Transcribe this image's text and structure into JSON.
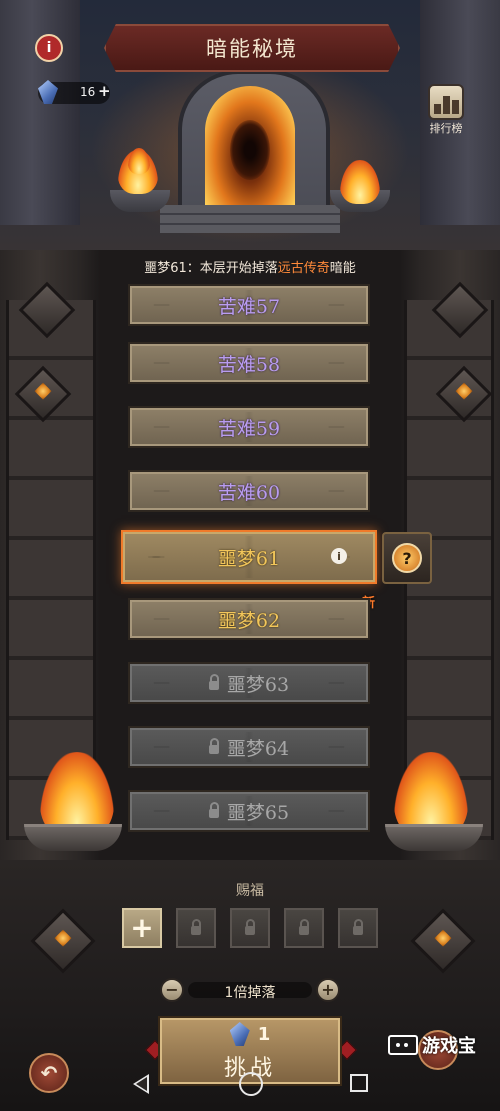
{
  "header": {
    "title": "暗能秘境",
    "info_icon": "info-icon",
    "currency": {
      "icon": "crystal-icon",
      "count": "16",
      "add_label": "+"
    },
    "leaderboard": {
      "icon": "ranking-icon",
      "label": "排行榜"
    }
  },
  "notice": {
    "prefix": "噩梦61：本层开始掉落",
    "highlight": "远古传奇",
    "suffix": "暗能",
    "highlight_color": "#ff8a3a"
  },
  "levels": [
    {
      "label": "苦难57",
      "state": "cleared"
    },
    {
      "label": "苦难58",
      "state": "cleared"
    },
    {
      "label": "苦难59",
      "state": "cleared"
    },
    {
      "label": "苦难60",
      "state": "cleared"
    },
    {
      "label": "噩梦61",
      "state": "selected"
    },
    {
      "label": "噩梦62",
      "state": "available"
    },
    {
      "label": "噩梦63",
      "state": "locked"
    },
    {
      "label": "噩梦64",
      "state": "locked"
    },
    {
      "label": "噩梦65",
      "state": "locked"
    }
  ],
  "level_info_icon": "i",
  "help_button": {
    "icon": "question-icon",
    "label": "?"
  },
  "new_tag": "新",
  "blessing": {
    "title": "赐福",
    "add_label": "+",
    "slots": [
      "locked",
      "locked",
      "locked",
      "locked"
    ]
  },
  "drop": {
    "minus_label": "−",
    "label": "1倍掉落",
    "plus_label": "+"
  },
  "challenge": {
    "cost": "1",
    "cost_icon": "crystal-icon",
    "label": "挑战"
  },
  "back_button": {
    "icon": "return-arrow-icon",
    "label": "↶"
  },
  "watermark": "游戏宝",
  "colors": {
    "purple_level": "#b99cf0",
    "gold_level": "#f2c65a",
    "locked_level": "#a7a7a7",
    "selected_border": "#f07a2a"
  }
}
